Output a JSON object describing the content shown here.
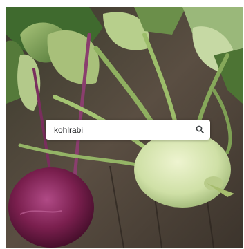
{
  "search": {
    "value": "kohlrabi",
    "icon": "search-icon"
  },
  "photo": {
    "subject_colors": {
      "purple_kohlrabi": "#7a1f4e",
      "green_kohlrabi": "#cfe0a6",
      "leaves": "#5e8a3e",
      "wood": "#4a4038"
    }
  }
}
